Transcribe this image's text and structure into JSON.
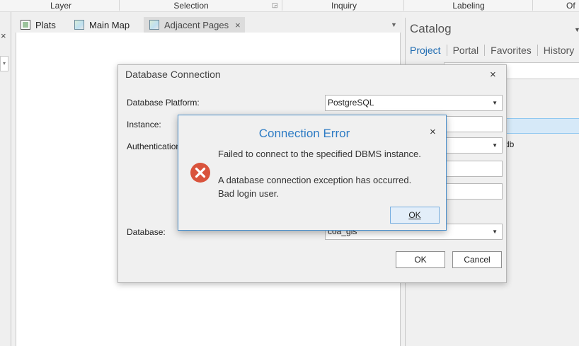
{
  "ribbon": {
    "groups": [
      "Layer",
      "Selection",
      "Inquiry",
      "Labeling",
      "Of"
    ]
  },
  "left_panel": {
    "close_glyph": "×",
    "dropdown_glyph": "▾"
  },
  "tabs": [
    {
      "label": "Plats",
      "icon": "layout-icon",
      "active": false
    },
    {
      "label": "Main Map",
      "icon": "map-icon",
      "active": false
    },
    {
      "label": "Adjacent Pages",
      "icon": "map-icon",
      "active": true
    }
  ],
  "tabstrip": {
    "close_glyph": "×",
    "overflow_glyph": "▼"
  },
  "catalog": {
    "title": "Catalog",
    "tabs": [
      "Project",
      "Portal",
      "Favorites",
      "History"
    ],
    "item_fragment": "db"
  },
  "db_dialog": {
    "title": "Database Connection",
    "close_glyph": "×",
    "platform_label": "Database Platform:",
    "platform_value": "PostgreSQL",
    "instance_label": "Instance:",
    "auth_label": "Authentication",
    "database_label": "Database:",
    "database_value": "coa_gis",
    "ok_label": "OK",
    "cancel_label": "Cancel"
  },
  "error_dialog": {
    "title": "Connection Error",
    "close_glyph": "×",
    "line1": "Failed to connect to the specified DBMS instance.",
    "line2": "A database connection exception has occurred.",
    "line3": "Bad login user.",
    "ok_label": "OK",
    "icon": "error-icon",
    "accent": "#2d7bc4",
    "icon_color": "#d9533c"
  }
}
